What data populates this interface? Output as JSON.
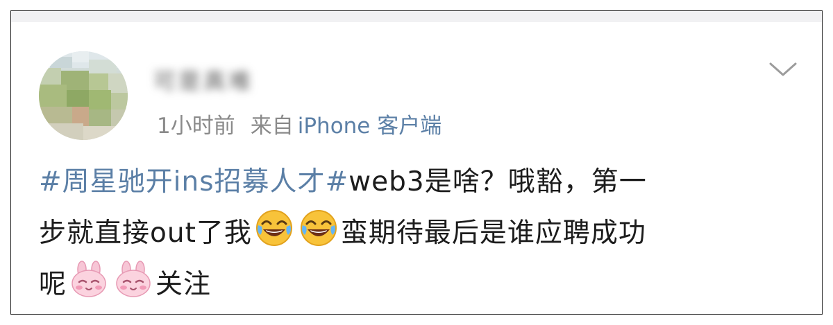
{
  "post": {
    "author": {
      "name": "可是真难"
    },
    "meta": {
      "time": "1小时前",
      "source_prefix": "来自",
      "source_link": "iPhone 客户端"
    },
    "content": {
      "hashtag": "#周星驰开ins招募人才#",
      "text_line1": "web3是啥？哦豁，第一",
      "text_line2a": "步就直接out了我",
      "text_line2b": "蛮期待最后是谁应聘成功",
      "text_line3a": "呢",
      "text_line3b": "关注"
    },
    "emojis": [
      "laughing-crying-emoji",
      "laughing-crying-emoji",
      "shy-bunny-emoji",
      "shy-bunny-emoji"
    ],
    "menu_icon": "chevron-down-icon"
  },
  "colors": {
    "link": "#5b7fa6",
    "meta": "#8a8a8a",
    "text": "#1c1c1c",
    "strip": "#f1f1f3"
  }
}
